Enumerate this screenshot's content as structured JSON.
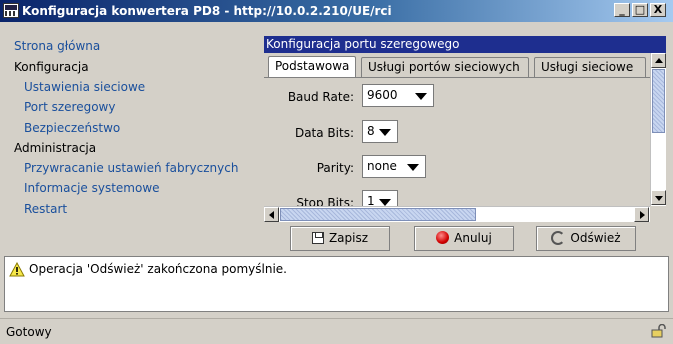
{
  "window": {
    "title": "Konfiguracja konwertera PD8 - http://10.0.2.210/UE/rci",
    "minimize": "_",
    "maximize": "□",
    "close": "X"
  },
  "nav": {
    "items": [
      {
        "label": "Strona główna",
        "kind": "link"
      },
      {
        "label": "Konfiguracja",
        "kind": "header"
      },
      {
        "label": "Ustawienia sieciowe",
        "kind": "link"
      },
      {
        "label": "Port szeregowy",
        "kind": "link"
      },
      {
        "label": "Bezpieczeństwo",
        "kind": "link"
      },
      {
        "label": "Administracja",
        "kind": "header"
      },
      {
        "label": "Przywracanie ustawień fabrycznych",
        "kind": "link"
      },
      {
        "label": "Informacje systemowe",
        "kind": "link"
      },
      {
        "label": "Restart",
        "kind": "link"
      }
    ]
  },
  "panel": {
    "title": "Konfiguracja portu szeregowego",
    "tabs": [
      {
        "label": "Podstawowa",
        "active": true
      },
      {
        "label": "Usługi portów sieciowych",
        "active": false
      },
      {
        "label": "Usługi sieciowe",
        "active": false
      }
    ],
    "fields": [
      {
        "label": "Baud Rate:",
        "value": "9600"
      },
      {
        "label": "Data Bits:",
        "value": "8"
      },
      {
        "label": "Parity:",
        "value": "none"
      },
      {
        "label": "Stop Bits:",
        "value": "1"
      }
    ],
    "buttons": {
      "save": "Zapisz",
      "cancel": "Anuluj",
      "refresh": "Odśwież"
    }
  },
  "message": "Operacja 'Odśwież' zakończona pomyślnie.",
  "status": "Gotowy",
  "colors": {
    "link": "#1a4f9c",
    "panel_header": "#1e2e8f",
    "chrome": "#d4d0c8"
  }
}
